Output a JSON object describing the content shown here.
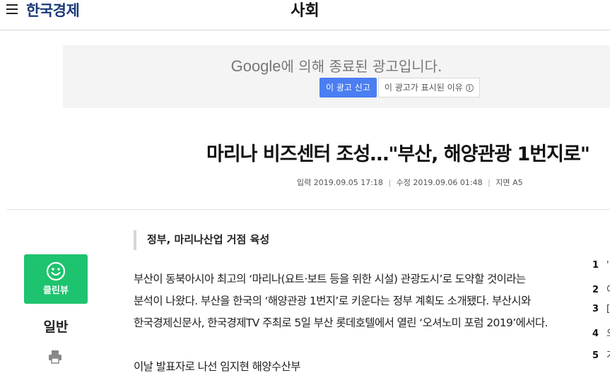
{
  "header": {
    "logo": "한국경제",
    "section": "사회"
  },
  "ad": {
    "brand": "Google",
    "message": "에 의해 종료된 광고입니다.",
    "report_label": "이 광고 신고",
    "why_label": "이 광고가 표시된 이유",
    "info_glyph": "i"
  },
  "article": {
    "headline": "마리나 비즈센터 조성…\"부산, 해양관광 1번지로\"",
    "meta": {
      "input_label": "입력",
      "input_time": "2019.09.05 17:18",
      "modified_label": "수정",
      "modified_time": "2019.09.06 01:48",
      "page_label": "지면",
      "page": "A5"
    },
    "subhead": "정부, 마리나산업 거점 육성",
    "paragraphs": [
      "부산이 동북아시아 최고의 ‘마리나(요트·보트 등을 위한 시설) 관광도시’로 도약할 것이라는",
      "분석이 나왔다. 부산을 한국의 ‘해양관광 1번지’로 키운다는 정부 계획도 소개됐다. 부산시와",
      "한국경제신문사, 한국경제TV 주최로 5일 부산 롯데호텔에서 열린 ‘오셔노미 포럼 2019’에서다."
    ],
    "next_line": "이날 발표자로 나선 임지현 해양수산부"
  },
  "sidebar": {
    "cleanview_label": "클린뷰",
    "category": "일반"
  },
  "ranking": [
    {
      "num": "1",
      "text": "'"
    },
    {
      "num": "2",
      "text": "이"
    },
    {
      "num": "3",
      "text": "[("
    },
    {
      "num": "4",
      "text": "오"
    },
    {
      "num": "5",
      "text": "가"
    }
  ],
  "colors": {
    "logo": "#1a3a7a",
    "ad_button": "#4a7ef2",
    "cleanview": "#1ec36f"
  }
}
